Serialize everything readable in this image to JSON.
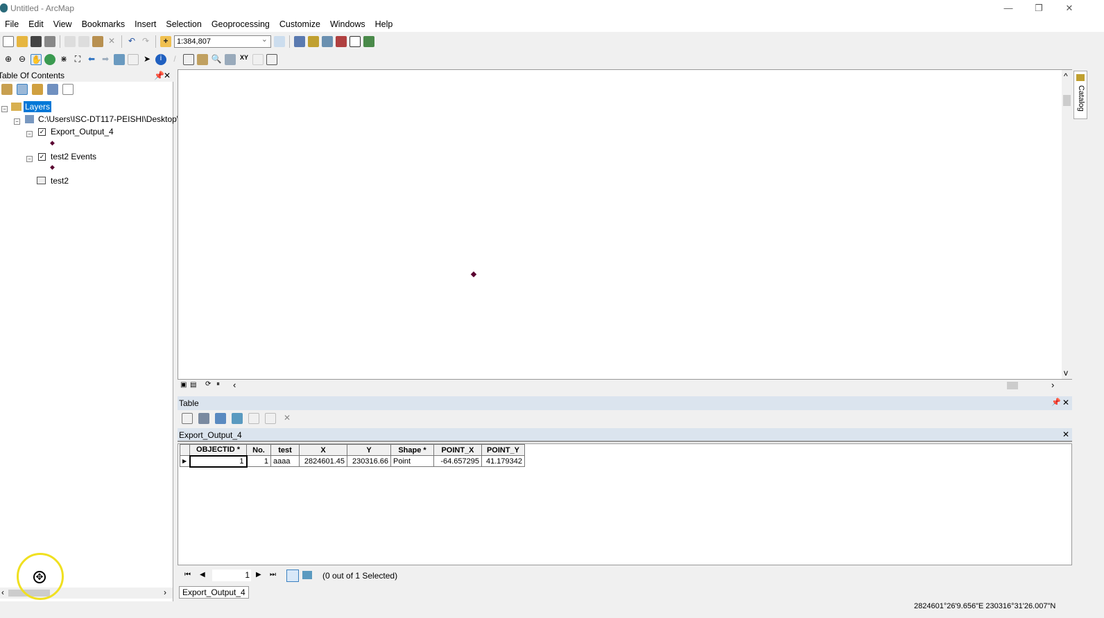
{
  "window": {
    "title": "Untitled - ArcMap",
    "min": "—",
    "restore": "❐",
    "close": "✕"
  },
  "menu": [
    "File",
    "Edit",
    "View",
    "Bookmarks",
    "Insert",
    "Selection",
    "Geoprocessing",
    "Customize",
    "Windows",
    "Help"
  ],
  "toolbar": {
    "scale": "1:384,807"
  },
  "toc": {
    "title": "Table Of Contents",
    "root": "Layers",
    "source": "C:\\Users\\ISC-DT117-PEISHI\\Desktop\\",
    "layers": [
      {
        "name": "Export_Output_4",
        "checked": true
      },
      {
        "name": "test2 Events",
        "checked": true
      }
    ],
    "table": "test2"
  },
  "catalog_tab": "Catalog",
  "table_window": {
    "title": "Table",
    "tab_title": "Export_Output_4",
    "columns": [
      "OBJECTID *",
      "No.",
      "test",
      "X",
      "Y",
      "Shape *",
      "POINT_X",
      "POINT_Y"
    ],
    "rows": [
      [
        "1",
        "1",
        "aaaa",
        "2824601.45",
        "230316.66",
        "Point",
        "-64.657295",
        "41.179342"
      ]
    ],
    "record": "1",
    "selection": "(0 out of 1 Selected)",
    "bottom_tab": "Export_Output_4"
  },
  "status": {
    "coords": "2824601°26'9.656\"E  230316°31'26.007\"N"
  },
  "colors": {
    "selection": "#0078d7",
    "point": "#5a0030",
    "cursor_highlight": "#f0e020"
  }
}
